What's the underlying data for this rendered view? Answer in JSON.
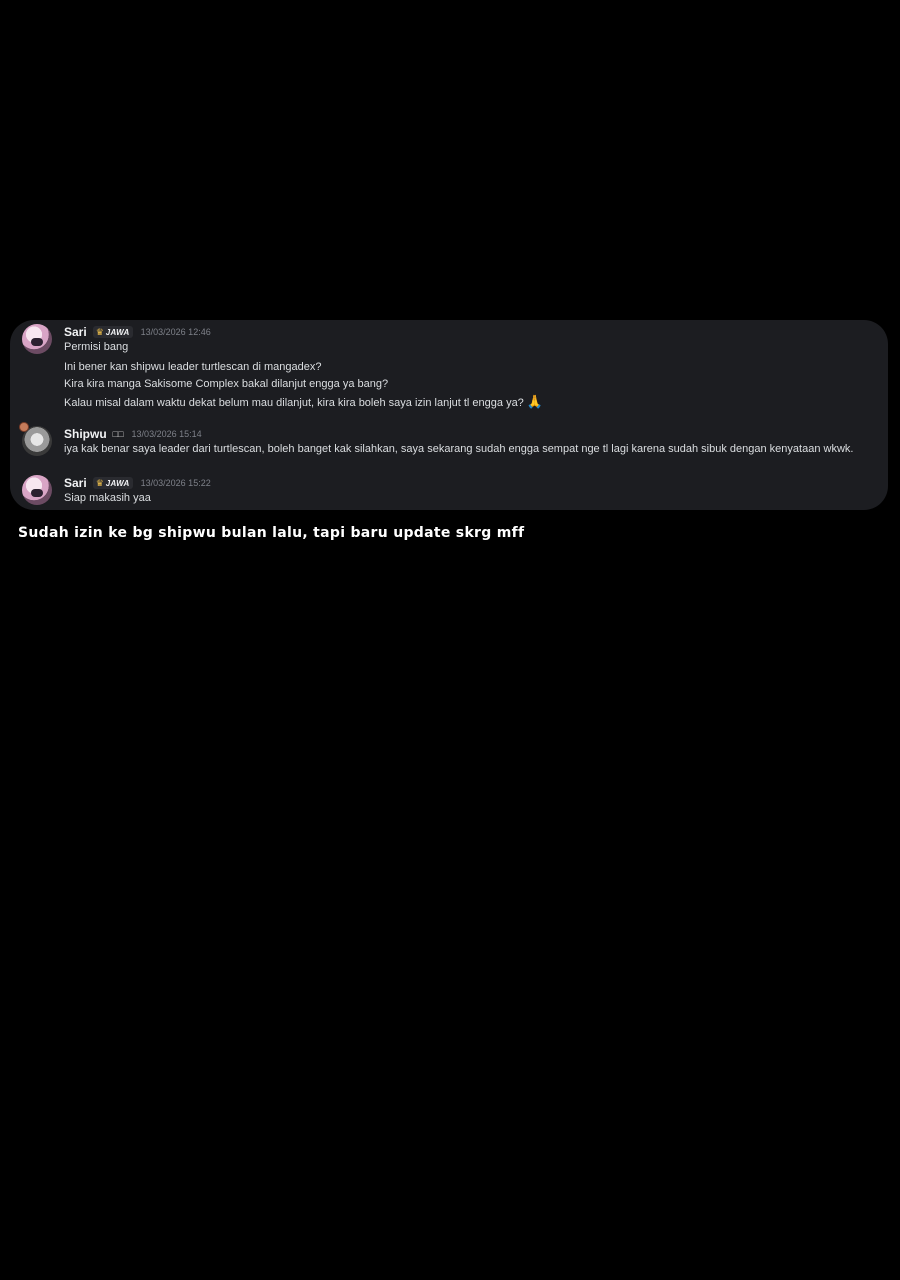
{
  "messages": [
    {
      "author": "Sari",
      "tag": "JAWA",
      "timestamp": "13/03/2026 12:46",
      "lines": [
        "Permisi bang",
        "Ini bener kan shipwu leader turtlescan di mangadex?",
        "Kira kira manga Sakisome Complex bakal dilanjut engga ya bang?",
        "Kalau misal dalam waktu dekat belum mau dilanjut, kira kira boleh saya izin lanjut tl engga ya?"
      ],
      "emoji": "🙏"
    },
    {
      "author": "Shipwu",
      "badge": "□□",
      "timestamp": "13/03/2026 15:14",
      "lines": [
        "iya kak benar saya leader dari turtlescan, boleh banget kak silahkan, saya sekarang sudah engga sempat nge tl lagi karena sudah sibuk dengan kenyataan wkwk."
      ]
    },
    {
      "author": "Sari",
      "tag": "JAWA",
      "timestamp": "13/03/2026 15:22",
      "lines": [
        "Siap makasih yaa"
      ]
    }
  ],
  "caption": "Sudah izin ke bg shipwu bulan lalu, tapi baru update skrg mff",
  "icons": {
    "crown": "crown-icon",
    "pray": "pray-emoji"
  },
  "colors": {
    "background": "#000000",
    "chat_bg": "#1c1d21",
    "text": "#dbdee1",
    "timestamp": "#7e8189"
  }
}
